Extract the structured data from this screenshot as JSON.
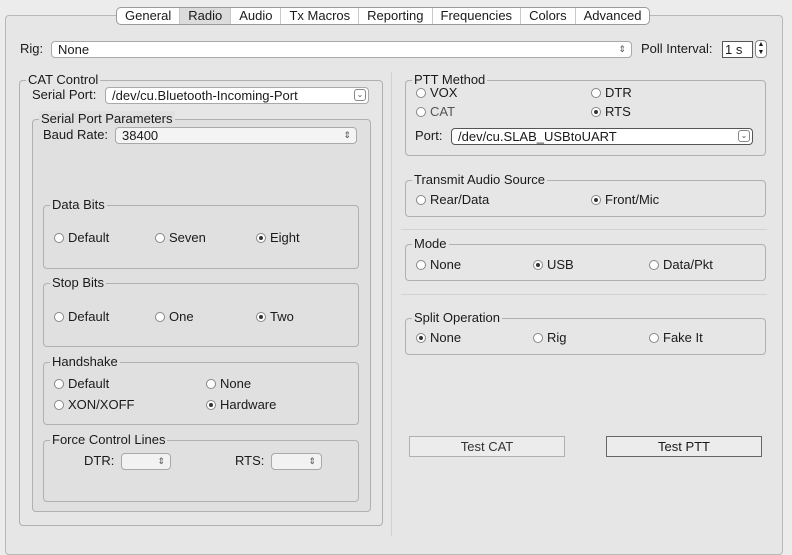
{
  "tabs": [
    {
      "label": "General"
    },
    {
      "label": "Radio",
      "active": true
    },
    {
      "label": "Audio"
    },
    {
      "label": "Tx Macros"
    },
    {
      "label": "Reporting"
    },
    {
      "label": "Frequencies"
    },
    {
      "label": "Colors"
    },
    {
      "label": "Advanced"
    }
  ],
  "rig": {
    "label": "Rig:",
    "value": "None",
    "poll_label": "Poll Interval:",
    "poll_value": "1 s"
  },
  "cat": {
    "title": "CAT Control",
    "serial_label": "Serial Port:",
    "serial_value": "/dev/cu.Bluetooth-Incoming-Port",
    "params": {
      "title": "Serial Port Parameters",
      "baud_label": "Baud Rate:",
      "baud_value": "38400",
      "data_bits": {
        "title": "Data Bits",
        "options": [
          "Default",
          "Seven",
          "Eight"
        ],
        "selected": "Eight"
      },
      "stop_bits": {
        "title": "Stop Bits",
        "options": [
          "Default",
          "One",
          "Two"
        ],
        "selected": "Two"
      },
      "handshake": {
        "title": "Handshake",
        "options": [
          "Default",
          "None",
          "XON/XOFF",
          "Hardware"
        ],
        "selected": "Hardware"
      },
      "force": {
        "title": "Force Control Lines",
        "dtr_label": "DTR:",
        "rts_label": "RTS:"
      }
    }
  },
  "ptt": {
    "title": "PTT Method",
    "options": [
      "VOX",
      "DTR",
      "CAT",
      "RTS"
    ],
    "selected": "RTS",
    "port_label": "Port:",
    "port_value": "/dev/cu.SLAB_USBtoUART"
  },
  "audio": {
    "title": "Transmit Audio Source",
    "options": [
      "Rear/Data",
      "Front/Mic"
    ],
    "selected": "Front/Mic"
  },
  "mode": {
    "title": "Mode",
    "options": [
      "None",
      "USB",
      "Data/Pkt"
    ],
    "selected": "USB"
  },
  "split": {
    "title": "Split Operation",
    "options": [
      "None",
      "Rig",
      "Fake It"
    ],
    "selected": "None"
  },
  "buttons": {
    "test_cat": "Test CAT",
    "test_ptt": "Test PTT"
  }
}
